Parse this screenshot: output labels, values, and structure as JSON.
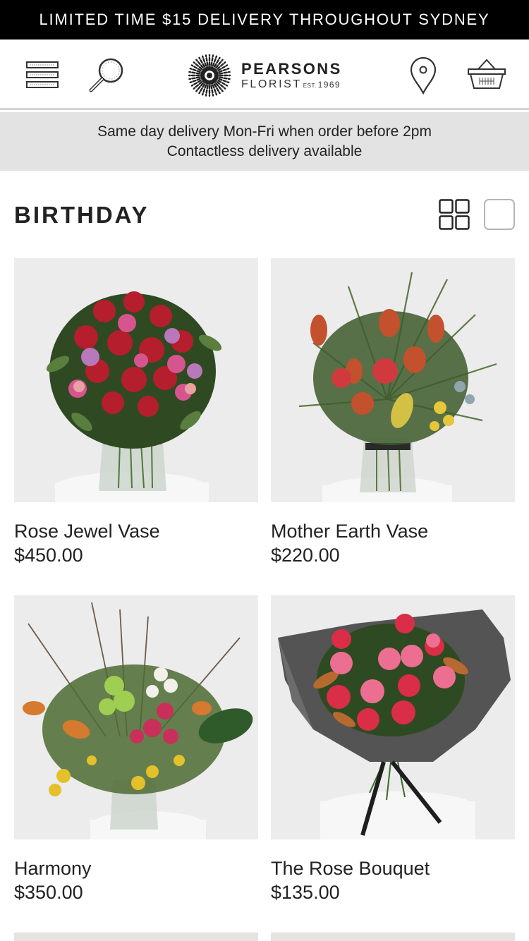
{
  "promo": {
    "text": "LIMITED TIME $15 DELIVERY THROUGHOUT SYDNEY"
  },
  "header": {
    "icons": [
      "menu-icon",
      "search-icon",
      "map-pin-icon",
      "basket-icon"
    ],
    "logo": {
      "name": "PEARSONS",
      "subtitle": "FLORIST",
      "est": "EST.",
      "year": "1969"
    }
  },
  "banner": {
    "line1": "Same day delivery Mon-Fri when order before 2pm",
    "line2": "Contactless delivery available"
  },
  "category": {
    "title": "BIRTHDAY",
    "view_icons": [
      "grid-view-icon",
      "list-view-icon"
    ]
  },
  "products": [
    {
      "name": "Rose Jewel Vase",
      "price": "$450.00"
    },
    {
      "name": "Mother Earth Vase",
      "price": "$220.00"
    },
    {
      "name": "Harmony",
      "price": "$350.00"
    },
    {
      "name": "The Rose Bouquet",
      "price": "$135.00"
    }
  ],
  "colors": {
    "promo_bg": "#000000",
    "banner_bg": "#e3e3e3",
    "text": "#222222",
    "photo_bg": "#ebebeb"
  }
}
